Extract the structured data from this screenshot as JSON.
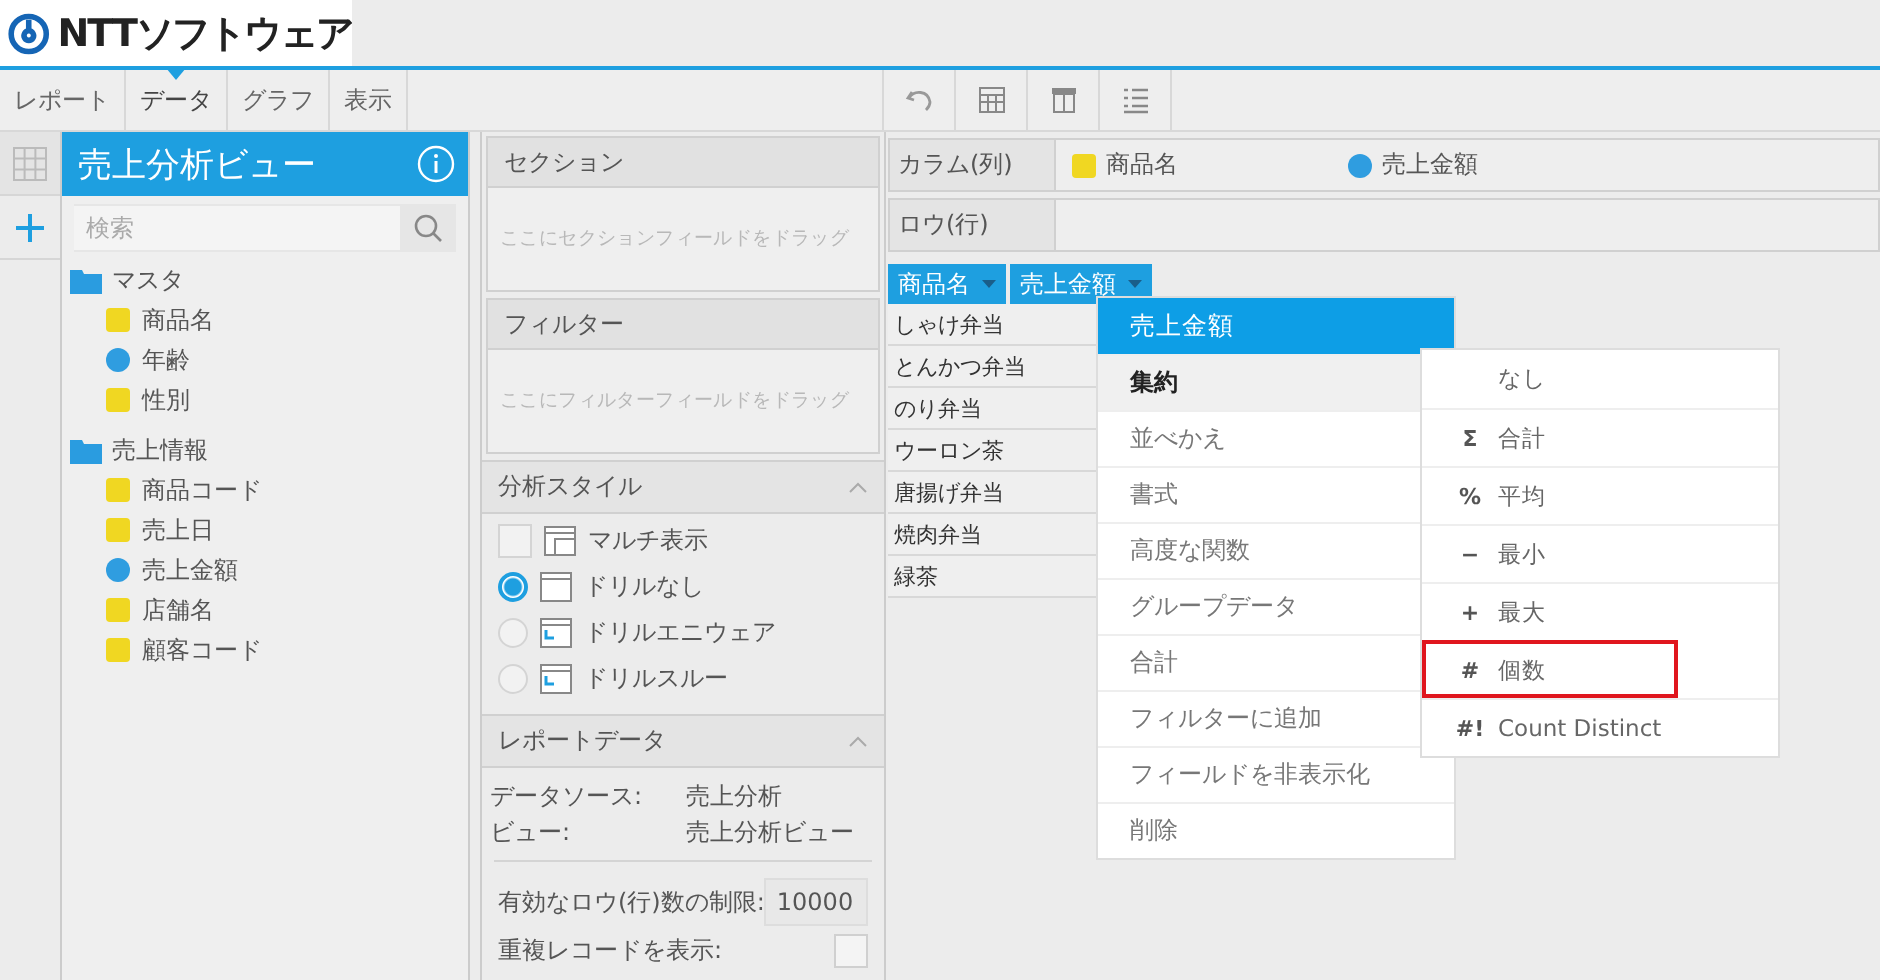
{
  "logo": {
    "text": "NTTソフトウェア"
  },
  "toolbar": {
    "tabs": [
      {
        "label": "レポート",
        "selected": false
      },
      {
        "label": "データ",
        "selected": true
      },
      {
        "label": "グラフ",
        "selected": false
      },
      {
        "label": "表示",
        "selected": false
      }
    ]
  },
  "field_panel": {
    "title": "売上分析ビュー",
    "search": {
      "placeholder": "検索"
    },
    "folders": [
      {
        "label": "マスタ",
        "children": [
          {
            "label": "商品名",
            "kind": "dimension"
          },
          {
            "label": "年齢",
            "kind": "metric"
          },
          {
            "label": "性別",
            "kind": "dimension"
          }
        ]
      },
      {
        "label": "売上情報",
        "children": [
          {
            "label": "商品コード",
            "kind": "dimension"
          },
          {
            "label": "売上日",
            "kind": "dimension"
          },
          {
            "label": "売上金額",
            "kind": "metric"
          },
          {
            "label": "店舗名",
            "kind": "dimension"
          },
          {
            "label": "顧客コード",
            "kind": "dimension"
          }
        ]
      }
    ]
  },
  "section": {
    "title": "セクション",
    "hint": "ここにセクションフィールドをドラッグ"
  },
  "filter": {
    "title": "フィルター",
    "hint": "ここにフィルターフィールドをドラッグ"
  },
  "analysis_style": {
    "title": "分析スタイル",
    "options": [
      {
        "kind": "checkbox",
        "label": "マルチ表示",
        "checked": false
      },
      {
        "kind": "radio",
        "label": "ドリルなし",
        "selected": true
      },
      {
        "kind": "radio",
        "label": "ドリルエニウェア",
        "selected": false
      },
      {
        "kind": "radio",
        "label": "ドリルスルー",
        "selected": false
      }
    ]
  },
  "report_data": {
    "title": "レポートデータ",
    "rows": [
      {
        "label": "データソース:",
        "value": "売上分析"
      },
      {
        "label": "ビュー:",
        "value": "売上分析ビュー"
      }
    ],
    "row_limit": {
      "label": "有効なロウ(行)数の制限:",
      "value": "10000"
    },
    "show_duplicates": {
      "label": "重複レコードを表示:",
      "checked": false
    }
  },
  "columns_shelf": {
    "label": "カラム(列)",
    "fields": [
      {
        "label": "商品名",
        "kind": "dimension"
      },
      {
        "label": "売上金額",
        "kind": "metric"
      }
    ]
  },
  "rows_shelf": {
    "label": "ロウ(行)"
  },
  "table": {
    "columns": [
      "商品名",
      "売上金額"
    ],
    "rows": [
      "しゃけ弁当",
      "とんかつ弁当",
      "のり弁当",
      "ウーロン茶",
      "唐揚げ弁当",
      "焼肉弁当",
      "緑茶"
    ]
  },
  "context_menu": {
    "title": "売上金額",
    "items": [
      {
        "label": "集約",
        "expanded": true
      },
      {
        "label": "並べかえ",
        "expanded": false
      },
      {
        "label": "書式",
        "expanded": false
      },
      {
        "label": "高度な関数",
        "expanded": false
      },
      {
        "label": "グループデータ",
        "expanded": false
      },
      {
        "label": "合計",
        "expanded": false
      },
      {
        "label": "フィルターに追加",
        "expanded": false
      },
      {
        "label": "フィールドを非表示化",
        "expanded": false
      },
      {
        "label": "削除",
        "expanded": false
      }
    ]
  },
  "submenu": {
    "items": [
      {
        "label": "なし",
        "highlighted": false
      },
      {
        "symbol": "Σ",
        "label": "合計",
        "highlighted": false
      },
      {
        "symbol": "%",
        "label": "平均",
        "highlighted": false
      },
      {
        "symbol": "−",
        "label": "最小",
        "highlighted": false
      },
      {
        "symbol": "+",
        "label": "最大",
        "highlighted": false
      },
      {
        "symbol": "#",
        "label": "個数",
        "highlighted": true
      },
      {
        "symbol": "#!",
        "label": "Count Distinct",
        "highlighted": false
      }
    ]
  }
}
